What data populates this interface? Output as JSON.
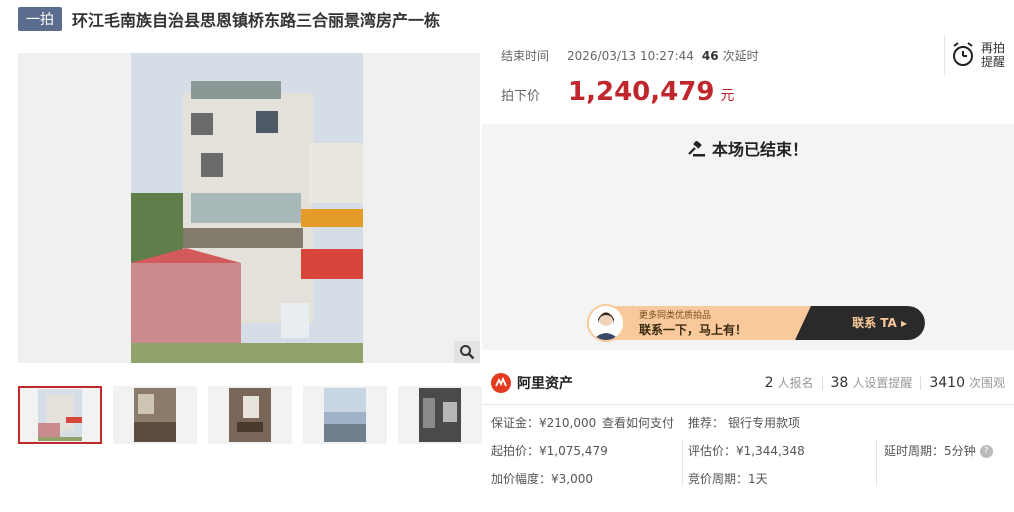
{
  "header": {
    "badge": "一拍",
    "title": "环江毛南族自治县思恩镇桥东路三合丽景湾房产一栋"
  },
  "auction": {
    "end_label": "结束时间",
    "end_time": "2026/03/13 10:27:44",
    "delay_count": "46",
    "delay_label": "次延时",
    "price_label": "拍下价",
    "price": "1,240,479",
    "price_unit": "元",
    "remind_label": "再拍提醒",
    "ended_text": "本场已结束！"
  },
  "banner": {
    "small": "更多同类优质拍品",
    "big": "联系一下，马上有！",
    "button": "联系 TA ▸"
  },
  "stats": {
    "brand": "阿里资产",
    "signup_count": "2",
    "signup_label": "人报名",
    "reminder_count": "38",
    "reminder_label": "人设置提醒",
    "view_count": "3410",
    "view_label": "次围观"
  },
  "details": {
    "deposit": "保证金：¥210,000",
    "how_pay": "查看如何支付",
    "recommend_label": "推荐：",
    "recommend_link": "银行专用款项",
    "start_price": "起拍价：¥1,075,479",
    "eval_price": "评估价：¥1,344,348",
    "delay_period": "延时周期：5分钟",
    "increment": "加价幅度：¥3,000",
    "bid_period": "竞价周期：1天"
  },
  "colors": {
    "accent": "#c0272d",
    "badge": "#5b6d8f",
    "link": "#3a7bd5"
  }
}
